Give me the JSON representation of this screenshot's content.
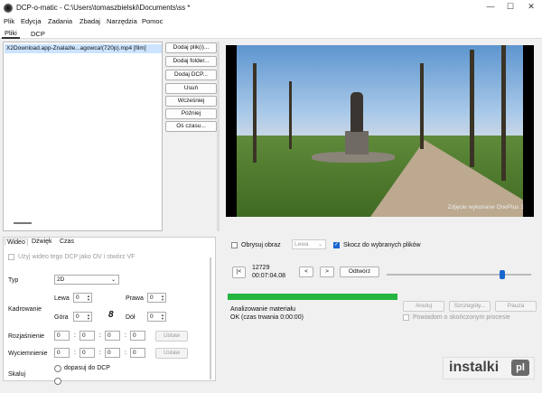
{
  "window": {
    "title": "DCP-o-matic - C:\\Users\\tomaszbielski\\Documents\\ss *",
    "minimize": "—",
    "maximize": "☐",
    "close": "✕"
  },
  "menu": [
    "Plik",
    "Edycja",
    "Zadania",
    "Zbadaj",
    "Narzędzia",
    "Pomoc"
  ],
  "tabs": [
    "Pliki",
    "DCP"
  ],
  "content": {
    "file": "X2Download.app-Znalazłe...agowca!(720p).mp4 [film]",
    "buttons": [
      "Dodaj plik(i)...",
      "Dodaj folder...",
      "Dodaj DCP...",
      "Usuń",
      "Wcześniej",
      "Później",
      "Oś czasu..."
    ]
  },
  "preview": {
    "watermark": "Zdjęcie wykonane OnePlus 11"
  },
  "panel": {
    "tabs": [
      "Wideo",
      "Dźwięk",
      "Czas"
    ],
    "use_video": "Użyj wideo tego DCP jako OV i stwórz VF",
    "type_label": "Typ",
    "type_value": "2D",
    "crop_label": "Kadrowanie",
    "left_label": "Lewa",
    "left_value": "0",
    "right_label": "Prawa",
    "right_value": "0",
    "top_label": "Góra",
    "top_value": "0",
    "bottom_label": "Dół",
    "bottom_value": "0",
    "link_icon": "8",
    "fade_in_label": "Rozjaśnienie",
    "fade_out_label": "Wyciemnienie",
    "time_zero": "0",
    "colon": ":",
    "set_label": "Ustaw",
    "scale_label": "Skaluj",
    "fit_dcp": "dopasuj do DCP"
  },
  "controls": {
    "outline": "Obrysuj obraz",
    "eye": "Lewa",
    "jump": "Skocz do wybranych plików",
    "start_btn": "|<",
    "frame": "12729",
    "timecode": "00:07:04.08",
    "prev_btn": "<",
    "next_btn": ">",
    "play_btn": "Odtwórz",
    "slider_position": 0.8
  },
  "job": {
    "status1": "Analizowanie materiału",
    "status2": "OK (czas trwania 0:00:00)",
    "cancel": "Anuluj",
    "details": "Szczegóły...",
    "pause": "Pauza",
    "notify": "Powiadom o skończonym procesie",
    "progress": 1.0
  },
  "logo": {
    "text": "instalki",
    "suffix": "pl"
  }
}
